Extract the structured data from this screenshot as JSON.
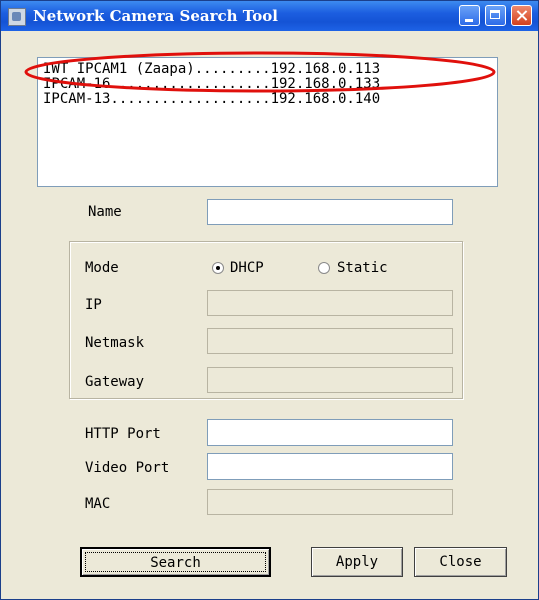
{
  "window": {
    "title": "Network Camera Search Tool"
  },
  "camera_list": [
    {
      "text": "IWT IPCAM1 (Zaapa).........192.168.0.113"
    },
    {
      "text": "IPCAM-16...................192.168.0.133"
    },
    {
      "text": "IPCAM-13...................192.168.0.140"
    }
  ],
  "form": {
    "name_label": "Name",
    "name_value": "",
    "mode_label": "Mode",
    "dhcp_label": "DHCP",
    "static_label": "Static",
    "mode_selected": "DHCP",
    "ip_label": "IP",
    "netmask_label": "Netmask",
    "gateway_label": "Gateway",
    "http_port_label": "HTTP  Port",
    "video_port_label": "Video Port",
    "mac_label": "MAC"
  },
  "buttons": {
    "search": "Search",
    "apply": "Apply",
    "close": "Close"
  },
  "colors": {
    "titlebar": "#1c5ee0",
    "window_bg": "#ece9d8",
    "highlight": "#e0100c"
  },
  "icons": [
    "app-icon",
    "minimize-icon",
    "maximize-icon",
    "close-icon"
  ]
}
